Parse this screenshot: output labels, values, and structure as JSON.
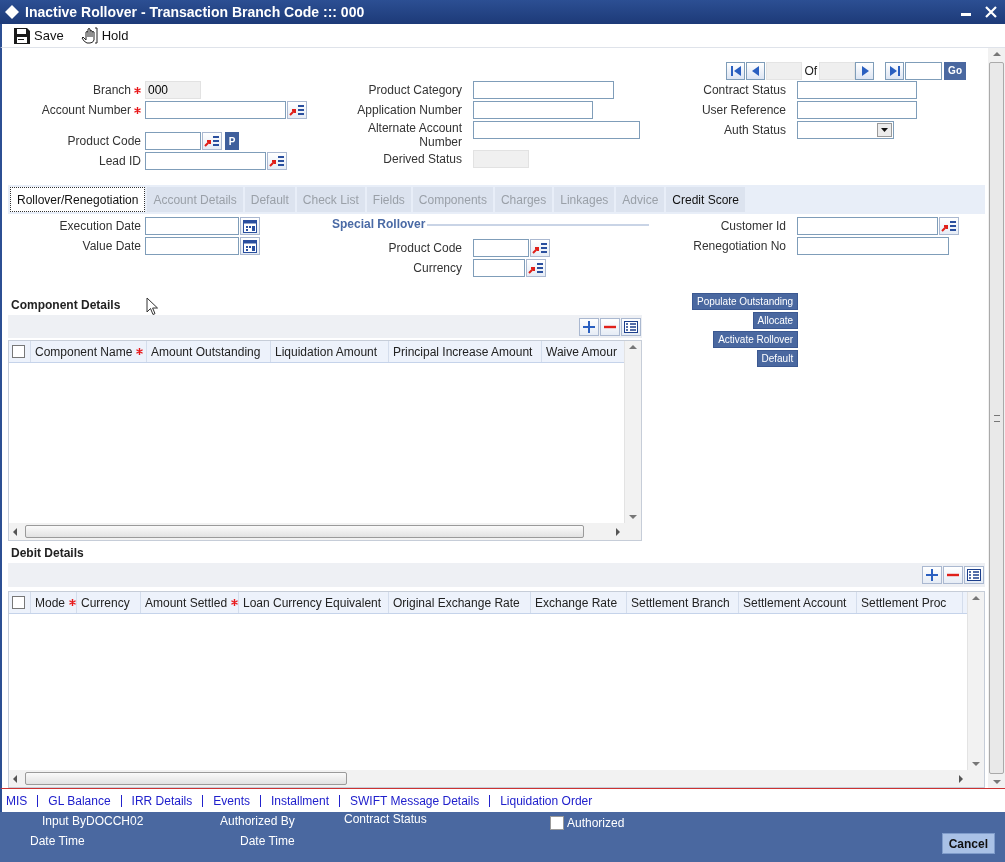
{
  "window": {
    "title": "Inactive Rollover - Transaction Branch Code ::: 000"
  },
  "toolbar": [
    {
      "kind": "save",
      "label": "Save"
    },
    {
      "kind": "hold",
      "label": "Hold"
    }
  ],
  "navigator": {
    "of_label": "Of",
    "go_label": "Go"
  },
  "header": {
    "columns": [
      {
        "fields": [
          {
            "label": "Branch",
            "required": true,
            "kind": "readonly",
            "value": "000"
          },
          {
            "label": "Account Number",
            "required": true,
            "kind": "lookup"
          },
          {
            "label": "Product Code",
            "required": false,
            "kind": "lookup_p",
            "button_label": "P"
          },
          {
            "label": "Lead ID",
            "required": false,
            "kind": "lookup"
          }
        ]
      },
      {
        "fields": [
          {
            "label": "Product Category",
            "required": false,
            "kind": "text"
          },
          {
            "label": "Application Number",
            "required": false,
            "kind": "text"
          },
          {
            "label": "Alternate Account Number",
            "required": false,
            "kind": "text"
          },
          {
            "label": "Derived Status",
            "required": false,
            "kind": "readonly"
          }
        ]
      },
      {
        "fields": [
          {
            "label": "Contract Status",
            "required": false,
            "kind": "text"
          },
          {
            "label": "User Reference",
            "required": false,
            "kind": "text"
          },
          {
            "label": "Auth Status",
            "required": false,
            "kind": "select"
          }
        ]
      }
    ]
  },
  "tabs": [
    {
      "label": "Rollover/Renegotiation",
      "selected": true,
      "disabled": false
    },
    {
      "label": "Account Details",
      "selected": false,
      "disabled": true
    },
    {
      "label": "Default",
      "selected": false,
      "disabled": true
    },
    {
      "label": "Check List",
      "selected": false,
      "disabled": true
    },
    {
      "label": "Fields",
      "selected": false,
      "disabled": true
    },
    {
      "label": "Components",
      "selected": false,
      "disabled": true
    },
    {
      "label": "Charges",
      "selected": false,
      "disabled": true
    },
    {
      "label": "Linkages",
      "selected": false,
      "disabled": true
    },
    {
      "label": "Advice",
      "selected": false,
      "disabled": true
    },
    {
      "label": "Credit Score",
      "selected": false,
      "disabled": false
    }
  ],
  "rollover": {
    "columns": [
      {
        "fields": [
          {
            "label": "Execution Date",
            "required": false,
            "kind": "date"
          },
          {
            "label": "Value Date",
            "required": false,
            "kind": "date"
          }
        ]
      },
      {
        "heading": "Special Rollover",
        "fields": [
          {
            "label": "Product Code",
            "required": false,
            "kind": "lookup"
          },
          {
            "label": "Currency",
            "required": false,
            "kind": "lookup"
          }
        ]
      },
      {
        "fields": [
          {
            "label": "Customer Id",
            "required": false,
            "kind": "lookup"
          },
          {
            "label": "Renegotiation No",
            "required": false,
            "kind": "text"
          }
        ]
      }
    ]
  },
  "component_details": {
    "title": "Component Details",
    "select_all_checked": false,
    "columns": [
      {
        "label": "Component Name",
        "required": true
      },
      {
        "label": "Amount Outstanding",
        "required": false
      },
      {
        "label": "Liquidation Amount",
        "required": false
      },
      {
        "label": "Principal Increase Amount",
        "required": false
      },
      {
        "label": "Waive Amour",
        "required": false
      }
    ],
    "actions": [
      "Populate Outstanding",
      "Allocate",
      "Activate Rollover",
      "Default"
    ]
  },
  "debit_details": {
    "title": "Debit Details",
    "select_all_checked": false,
    "columns": [
      {
        "label": "Mode",
        "required": true
      },
      {
        "label": "Currency",
        "required": false
      },
      {
        "label": "Amount Settled",
        "required": true
      },
      {
        "label": "Loan Currency Equivalent",
        "required": false
      },
      {
        "label": "Original Exchange Rate",
        "required": false
      },
      {
        "label": "Exchange Rate",
        "required": false
      },
      {
        "label": "Settlement Branch",
        "required": false
      },
      {
        "label": "Settlement Account",
        "required": false
      },
      {
        "label": "Settlement Proc",
        "required": false
      }
    ]
  },
  "links": [
    "MIS",
    "GL Balance",
    "IRR Details",
    "Events",
    "Installment",
    "SWIFT Message Details",
    "Liquidation Order"
  ],
  "audit": {
    "input_by": {
      "label": "Input By",
      "value": "DOCCH02"
    },
    "input_date": {
      "label": "Date Time"
    },
    "authorized_by": {
      "label": "Authorized By"
    },
    "authorized_date": {
      "label": "Date Time"
    },
    "contract_status": {
      "label": "Contract Status"
    },
    "authorized": {
      "label": "Authorized",
      "checked": false
    }
  },
  "cancel": "Cancel"
}
